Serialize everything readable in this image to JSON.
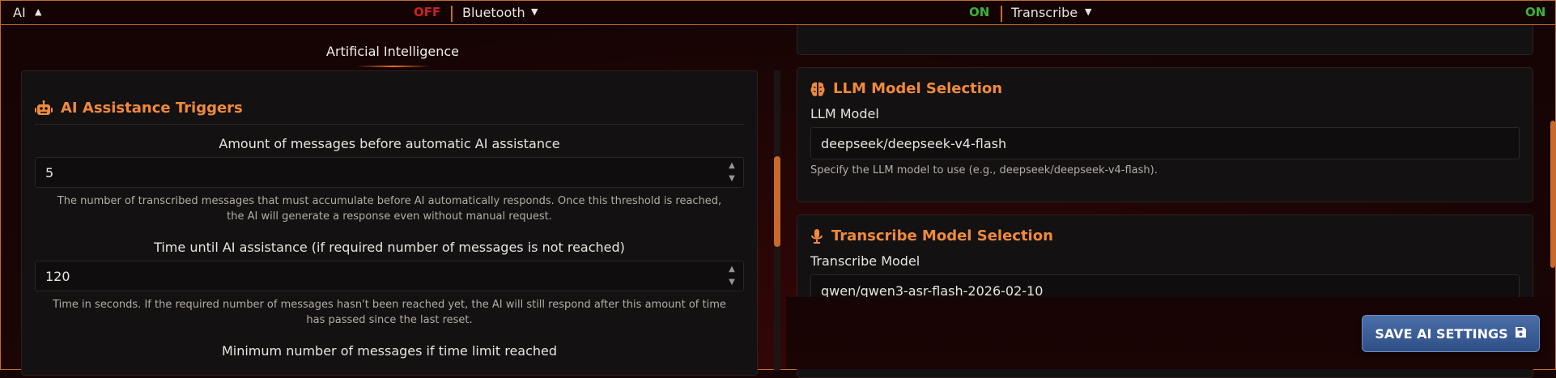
{
  "topbar": {
    "items": [
      {
        "label": "AI",
        "state": "OFF",
        "caret": "▲",
        "state_color": "#d02020"
      },
      {
        "label": "Bluetooth",
        "state": "ON",
        "caret": "▼",
        "state_color": "#3cb23c"
      },
      {
        "label": "Transcribe",
        "state": "ON",
        "caret": "▼",
        "state_color": "#3cb23c"
      }
    ]
  },
  "left": {
    "section_title": "Artificial Intelligence",
    "card_title": "AI Assistance Triggers",
    "card_icon": "robot-icon",
    "fields": [
      {
        "label": "Amount of messages before automatic AI assistance",
        "value": "5",
        "help_line1": "The number of transcribed messages that must accumulate before AI automatically responds. Once this threshold is reached,",
        "help_line2": "the AI will generate a response even without manual request."
      },
      {
        "label": "Time until AI assistance (if required number of messages is not reached)",
        "value": "120",
        "help_line1": "Time in seconds. If the required number of messages hasn't been reached yet, the AI will still respond after this amount of time",
        "help_line2": "has passed since the last reset."
      },
      {
        "label": "Minimum number of messages if time limit reached"
      }
    ]
  },
  "right": {
    "llm": {
      "title": "LLM Model Selection",
      "icon": "brain-icon",
      "label": "LLM Model",
      "value": "deepseek/deepseek-v4-flash",
      "help": "Specify the LLM model to use (e.g., deepseek/deepseek-v4-flash)."
    },
    "transcribe": {
      "title": "Transcribe Model Selection",
      "icon": "microphone-icon",
      "label": "Transcribe Model",
      "value": "qwen/qwen3-asr-flash-2026-02-10"
    }
  },
  "save_button": {
    "label": "SAVE AI SETTINGS",
    "icon": "floppy-disk-icon"
  },
  "colors": {
    "accent": "#f08a3c",
    "border": "#c8692e",
    "button": "#3b5d96"
  }
}
